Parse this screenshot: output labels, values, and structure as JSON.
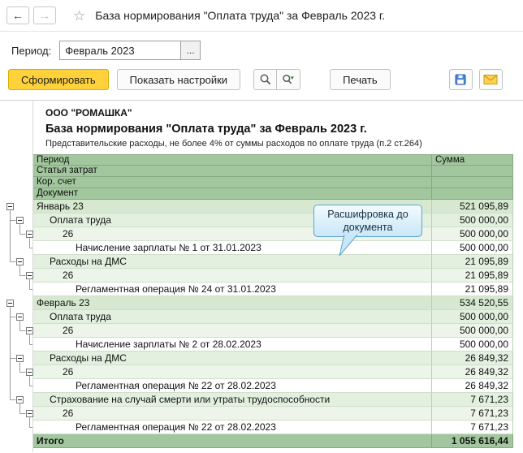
{
  "nav": {
    "title": "База нормирования \"Оплата труда\" за Февраль 2023 г.",
    "back_icon": "←",
    "forward_icon": "→",
    "star_icon": "☆"
  },
  "period": {
    "label": "Период:",
    "value": "Февраль 2023",
    "ellipsis": "..."
  },
  "toolbar": {
    "generate_label": "Сформировать",
    "settings_label": "Показать настройки",
    "print_label": "Печать",
    "icons": {
      "search": "magnifier",
      "search_next": "magnifier-with-arrow",
      "save": "floppy-disk",
      "mail": "envelope"
    }
  },
  "report": {
    "company": "ООО \"РОМАШКА\"",
    "title": "База нормирования \"Оплата труда\" за Февраль 2023 г.",
    "note": "Представительские расходы, не более 4% от суммы расходов по оплате труда (п.2 ст.264)",
    "header_rows": [
      "Период",
      "Статья затрат",
      "Кор. счет",
      "Документ"
    ],
    "sum_header": "Сумма",
    "rows": [
      {
        "level": 1,
        "label": "Январь 23",
        "sum": "521 095,89"
      },
      {
        "level": 2,
        "label": "Оплата труда",
        "sum": "500 000,00"
      },
      {
        "level": 3,
        "label": "26",
        "sum": "500 000,00"
      },
      {
        "level": 4,
        "label": "Начисление зарплаты № 1 от 31.01.2023",
        "sum": "500 000,00"
      },
      {
        "level": 2,
        "label": "Расходы на ДМС",
        "sum": "21 095,89"
      },
      {
        "level": 3,
        "label": "26",
        "sum": "21 095,89"
      },
      {
        "level": 4,
        "label": "Регламентная операция № 24 от 31.01.2023",
        "sum": "21 095,89"
      },
      {
        "level": 1,
        "label": "Февраль 23",
        "sum": "534 520,55"
      },
      {
        "level": 2,
        "label": "Оплата труда",
        "sum": "500 000,00"
      },
      {
        "level": 3,
        "label": "26",
        "sum": "500 000,00"
      },
      {
        "level": 4,
        "label": "Начисление зарплаты № 2 от 28.02.2023",
        "sum": "500 000,00"
      },
      {
        "level": 2,
        "label": "Расходы на ДМС",
        "sum": "26 849,32"
      },
      {
        "level": 3,
        "label": "26",
        "sum": "26 849,32"
      },
      {
        "level": 4,
        "label": "Регламентная операция № 22 от 28.02.2023",
        "sum": "26 849,32"
      },
      {
        "level": 2,
        "label": "Страхование на случай смерти или утраты трудоспособности",
        "sum": "7 671,23"
      },
      {
        "level": 3,
        "label": "26",
        "sum": "7 671,23"
      },
      {
        "level": 4,
        "label": "Регламентная операция № 22 от 28.02.2023",
        "sum": "7 671,23"
      }
    ],
    "total": {
      "label": "Итого",
      "sum": "1 055 616,44"
    }
  },
  "callout": {
    "text": "Расшифровка до документа"
  },
  "colors": {
    "header_green": "#a2c69d",
    "group_level1": "#d6e8d0",
    "group_level2": "#e3f0df",
    "group_level3": "#edf5ea",
    "accent_yellow": "#ffd23b",
    "callout_border": "#5ba3d0"
  }
}
